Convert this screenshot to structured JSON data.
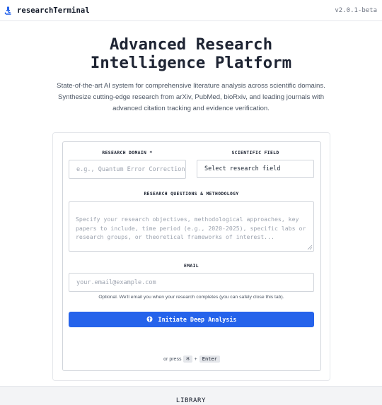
{
  "app": {
    "name": "researchTerminal",
    "version": "v2.0.1-beta",
    "logo_icon": "microscope-icon"
  },
  "hero": {
    "title": "Advanced Research Intelligence Platform",
    "subtitle": "State-of-the-art AI system for comprehensive literature analysis across scientific domains. Synthesize cutting-edge research from arXiv, PubMed, bioRxiv, and leading journals with advanced citation tracking and evidence verification."
  },
  "form": {
    "domain_label": "RESEARCH DOMAIN *",
    "domain_placeholder": "e.g., Quantum Error Correction",
    "field_label": "SCIENTIFIC FIELD",
    "field_value": "Select research field",
    "questions_label": "RESEARCH QUESTIONS & METHODOLOGY",
    "questions_placeholder": "Specify your research objectives, methodological approaches, key papers to include, time period (e.g., 2020-2025), specific labs or research groups, or theoretical frameworks of interest...",
    "email_label": "EMAIL",
    "email_placeholder": "your.email@example.com",
    "email_note": "Optional. We'll email you when your research completes (you can safely close this tab).",
    "submit_label": "Initiate Deep Analysis",
    "submit_icon": "brain-icon",
    "shortcut_prefix": "or press",
    "shortcut_key1": "⌘",
    "shortcut_plus": "+",
    "shortcut_key2": "Enter"
  },
  "library": {
    "label": "LIBRARY"
  },
  "colors": {
    "accent": "#2563eb",
    "text": "#1e2433",
    "border": "#d1d5db",
    "footer_bg": "#f3f4f6"
  }
}
